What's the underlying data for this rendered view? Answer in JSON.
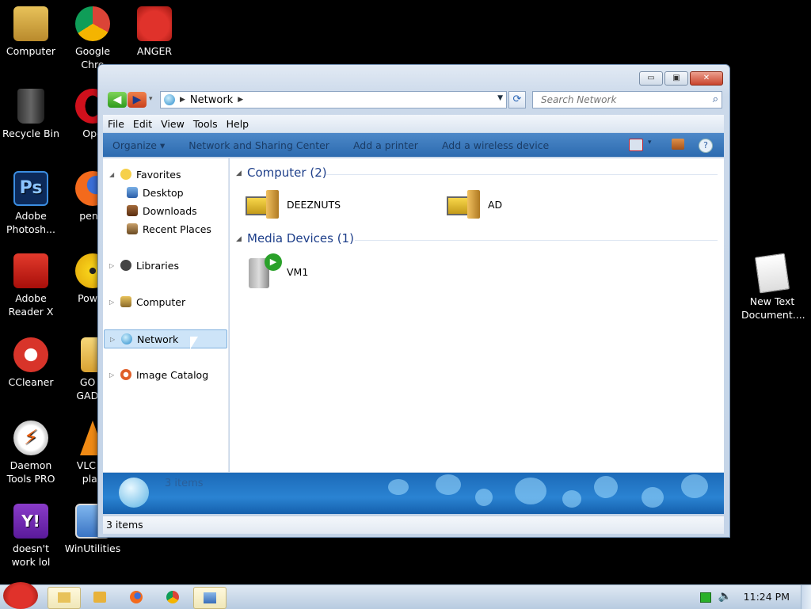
{
  "desktop": {
    "icons": [
      {
        "label": "Computer"
      },
      {
        "label": "Google\nChro"
      },
      {
        "label": "ANGER"
      },
      {
        "label": "Recycle Bin"
      },
      {
        "label": "Ope"
      },
      {
        "label": "Adobe\nPhotosh..."
      },
      {
        "label": "penis"
      },
      {
        "label": "Adobe\nReader X"
      },
      {
        "label": "Power"
      },
      {
        "label": "CCleaner"
      },
      {
        "label": "GO C\nGADGI"
      },
      {
        "label": "Daemon\nTools PRO"
      },
      {
        "label": "VLC m\nplay"
      },
      {
        "label": "doesn't\nwork lol"
      },
      {
        "label": "WinUtilities"
      },
      {
        "label": "New Text\nDocument...."
      }
    ]
  },
  "window": {
    "title_buttons": {
      "minimize": "▭",
      "maximize": "▣",
      "close": "✕"
    },
    "address": {
      "crumb": "Network"
    },
    "search": {
      "placeholder": "Search Network"
    },
    "menu": [
      "File",
      "Edit",
      "View",
      "Tools",
      "Help"
    ],
    "commands": {
      "organize": "Organize ▾",
      "network_sharing": "Network and Sharing Center",
      "add_printer": "Add a printer",
      "add_wireless": "Add a wireless device"
    },
    "nav": {
      "favorites": "Favorites",
      "desktop": "Desktop",
      "downloads": "Downloads",
      "recent": "Recent Places",
      "libraries": "Libraries",
      "computer": "Computer",
      "network": "Network",
      "image_catalog": "Image Catalog"
    },
    "groups": {
      "computer": {
        "header": "Computer (2)",
        "items": [
          "DEEZNUTS",
          "AD"
        ]
      },
      "media": {
        "header": "Media Devices (1)",
        "items": [
          "VM1"
        ]
      }
    },
    "details_count": "3 items",
    "status": "3 items"
  },
  "taskbar": {
    "clock": "11:24 PM"
  },
  "colors": {
    "accent": "#2c6bb0",
    "group_header": "#1e3f8a",
    "selection": "#cde4f8"
  }
}
